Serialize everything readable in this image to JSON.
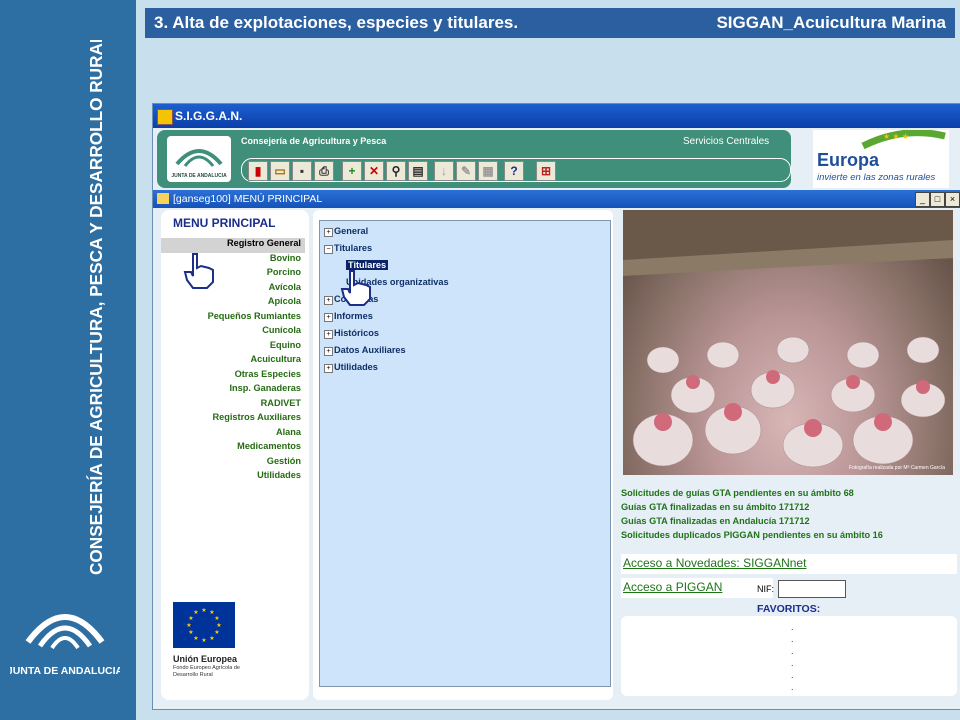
{
  "slide": {
    "title_left": "3. Alta de explotaciones, especies y titulares.",
    "title_right": "SIGGAN_Acuicultura Marina",
    "sidebar_vertical_text": "CONSEJERÍA DE AGRICULTURA, PESCA Y DESARROLLO RURAL",
    "sidebar_logo_text": "JUNTA DE ANDALUCIA"
  },
  "app": {
    "window_title": "S.I.G.G.A.N.",
    "banner_title": "Consejería de Agricultura y Pesca",
    "banner_right": "Servicios Centrales",
    "banner_logo_text": "JUNTA DE ANDALUCIA",
    "europa_title": "Europa",
    "europa_tagline": "invierte en las zonas rurales",
    "toolbar_buttons": [
      "exit-icon",
      "open-folder-icon",
      "save-icon",
      "print-icon",
      "add-icon",
      "delete-icon",
      "search-icon",
      "edit-icon",
      "down-arrow-icon",
      "pencil-icon",
      "document-icon",
      "help-icon",
      "structure-icon"
    ],
    "help_label": "?"
  },
  "inner": {
    "window_title": "[ganseg100] MENÚ PRINCIPAL",
    "win_min": "_",
    "win_max": "□",
    "win_close": "×"
  },
  "menu": {
    "title": "MENU PRINCIPAL",
    "items": [
      "Registro General",
      "Bovino",
      "Porcino",
      "Avícola",
      "Apícola",
      "Pequeños Rumiantes",
      "Cunícola",
      "Equino",
      "Acuicultura",
      "Otras Especies",
      "Insp. Ganaderas",
      "RADIVET",
      "Registros Auxiliares",
      "Alana",
      "Medicamentos",
      "Gestión",
      "Utilidades"
    ],
    "selected_index": 0,
    "eu_text1": "Unión Europea",
    "eu_text2": "Fondo Europeo Agrícola de Desarrollo Rural"
  },
  "tree": {
    "nodes": [
      "General",
      "Titulares",
      "Titulares",
      "Unidades organizativas",
      "Consultas",
      "Informes",
      "Históricos",
      "Datos Auxiliares",
      "Utilidades"
    ]
  },
  "right": {
    "photo_caption": "Fotografía realizada por Mª Carmen García",
    "stats": [
      "Solicitudes de guías GTA pendientes en su ámbito 68",
      "Guías GTA finalizadas en su ámbito 171712",
      "Guías GTA finalizadas en Andalucía 171712",
      "Solicitudes duplicados PIGGAN pendientes en su ámbito 16"
    ],
    "novedades_link": "Acceso a Novedades: SIGGANnet",
    "piggan_link": "Acceso a PIGGAN",
    "nif_label": "NIF:",
    "nif_value": "",
    "favoritos_title": "FAVORITOS:",
    "favoritos_items": [
      ".",
      ".",
      ".",
      ".",
      ".",
      "."
    ]
  }
}
